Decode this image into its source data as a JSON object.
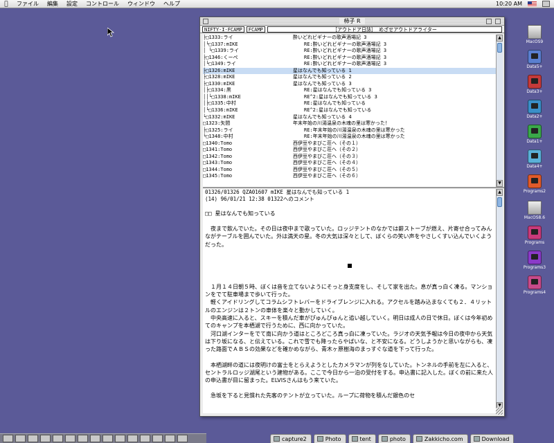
{
  "menubar": {
    "menus": [
      "ファイル",
      "編集",
      "設定",
      "コントロール",
      "ウィンドウ",
      "ヘルプ"
    ],
    "clock": "10:20 AM"
  },
  "window": {
    "title": "柿子 R",
    "path": [
      "NIFTY-I-FCAMP",
      "FCAMP",
      "［アウトドア日誌］ めざせアウトドアライター"
    ],
    "thread_rows": [
      {
        "tree": "  ├□",
        "num": "1333:ライ",
        "subj": "酔いどれビギナーの歌声酒場記 3"
      },
      {
        "tree": "  │└□",
        "num": "1337:mIKE",
        "subj": "RE:酔いどれビギナーの歌声酒場記 3"
      },
      {
        "tree": "  │  └□",
        "num": "1339:ライ",
        "subj": "RE:酔いどれビギナーの歌声酒場記 3"
      },
      {
        "tree": "  ├□",
        "num": "1346:くーぺ",
        "subj": "RE:酔いどれビギナーの歌声酒場記 3"
      },
      {
        "tree": "  │└□",
        "num": "1349:ライ",
        "subj": "RE:酔いどれビギナーの歌声酒場記 3"
      },
      {
        "tree": "├□",
        "num": "1326:mIKE",
        "subj": "星はなんでも知っている  1",
        "selected": true
      },
      {
        "tree": "├□",
        "num": "1328:mIKE",
        "subj": "星はなんでも知っている  2"
      },
      {
        "tree": "├□",
        "num": "1330:mIKE",
        "subj": "星はなんでも知っている  3"
      },
      {
        "tree": "│├□",
        "num": "1334:黒",
        "subj": "RE:星はなんでも知っている  3"
      },
      {
        "tree": "││└□",
        "num": "1338:mIKE",
        "subj": "RE^2:星はなんでも知っている  3"
      },
      {
        "tree": "│├□",
        "num": "1335:中村",
        "subj": "RE:星はなんでも知っている"
      },
      {
        "tree": "│└□",
        "num": "1336:mIKE",
        "subj": "RE^2:星はなんでも知っている"
      },
      {
        "tree": "└□",
        "num": "1332:mIKE",
        "subj": "星はなんでも知っている  4"
      },
      {
        "tree": "□",
        "num": "1323:矢間",
        "subj": "年末年始の川湯温泉の木魂の里は寒かった！"
      },
      {
        "tree": " ├□",
        "num": "1325:ライ",
        "subj": "RE:年末年始の川湯温泉の木魂の里は寒かった"
      },
      {
        "tree": " └□",
        "num": "1348:中村",
        "subj": "RE:年末年始の川湯温泉の木魂の里は寒かった"
      },
      {
        "tree": "□",
        "num": "1340:Tomo",
        "subj": "西伊豆やまびこ荘へ（その１）"
      },
      {
        "tree": "□",
        "num": "1341:Tomo",
        "subj": "西伊豆やまびこ荘へ（その２）"
      },
      {
        "tree": "□",
        "num": "1342:Tomo",
        "subj": "西伊豆やまびこ荘へ（その３）"
      },
      {
        "tree": "□",
        "num": "1343:Tomo",
        "subj": "西伊豆やまびこ荘へ（その４）"
      },
      {
        "tree": "□",
        "num": "1344:Tomo",
        "subj": "西伊豆やまびこ荘へ（その５）"
      },
      {
        "tree": "□",
        "num": "1345:Tomo",
        "subj": "西伊豆やまびこ荘へ（その６）"
      }
    ],
    "message": {
      "header1": "01326/01326 QZA01607  mIKE          星はなんでも知っている  1",
      "header2": "(14)   96/01/21 12:38  01322へのコメント",
      "heading": "□□   星はなんでも知っている",
      "para1": "夜まで飲んでいた。その日は夜中まで歌っていた。ロッジテントのなかでは薪ストーブが燃え、片寄せ合ってみんながテーブルを囲んでいた。外は満天の星。冬の大気は深々として、ぼくらの笑い声をやさしくすい込んでいくようだった。",
      "para2": "１月１４日朝５時、ぼくは音を立てないようにそっと身支度をし、そして家を出た。息が真っ白く凍る。マンションをでて駐車場まで歩いて行った。",
      "para3": "軽くアイドリングしてコラムシフトレバーをドライブレンジに入れる。アクセルを踏み込まなくても２．４リットルのエンジンは２トンの車体を楽々と動かしていく。",
      "para4": "中央高速に入ると、スキーを積んだ車がぴゅんぴゅんと追い越していく。明日は成人の日で休日。ぼくは今年初めてのキャンプを本栖湖で行うために、西に向かっていた。",
      "para5": "河口湖インターをでて南に向かう道はところどころ真っ白に凍っていた。ラジオの天気予報は今日の夜中から天気は下り坂になる、と伝えている。これで雪でも降ったらやばいな、と不安になる。どうしようかと思いながらも、凍った路面でＡＢＳの効果などを確かめながら、青木ヶ原樹海のまっすぐな道を下って行った。",
      "para6": "本栖湖畔の道には夜明けの富士をとらえようとしたカメラマンが列をなしていた。トンネルの手前を左に入ると、セントラルロッジ湖尾という建物がある。ここで今日から一泊の受付をする。申込書に記入した。ぼくの前に来た人の申込書が目に留まった。ELVISさんはもう来ていた。",
      "para7": "急坂を下ると見慣れた先客のテントが立っていた。ループに荷物を積んだ銀色のセ"
    }
  },
  "desktop_icons": [
    {
      "label": "MacOS9",
      "color": "#d8d8d8",
      "kind": "drive"
    },
    {
      "label": "Data5+",
      "color": "#5a7fd0",
      "kind": "imac"
    },
    {
      "label": "Data3+",
      "color": "#c53a3a",
      "kind": "imac"
    },
    {
      "label": "Data2+",
      "color": "#3a8fc8",
      "kind": "imac"
    },
    {
      "label": "Data1+",
      "color": "#3aa84a",
      "kind": "imac"
    },
    {
      "label": "Data4+",
      "color": "#5ab0d8",
      "kind": "imac"
    },
    {
      "label": "Programs2",
      "color": "#e05a2a",
      "kind": "imac"
    },
    {
      "label": "MacOS8.6",
      "color": "#d8d8d8",
      "kind": "drive"
    },
    {
      "label": "Programs",
      "color": "#c83a7a",
      "kind": "imac"
    },
    {
      "label": "Programs3",
      "color": "#8a3ac8",
      "kind": "imac"
    },
    {
      "label": "Programs4",
      "color": "#c84a8a",
      "kind": "imac"
    }
  ],
  "taskbar": {
    "tabs": [
      "capture2",
      "Photo",
      "tent",
      "photo",
      "Zakkicho.com",
      "Download"
    ]
  }
}
